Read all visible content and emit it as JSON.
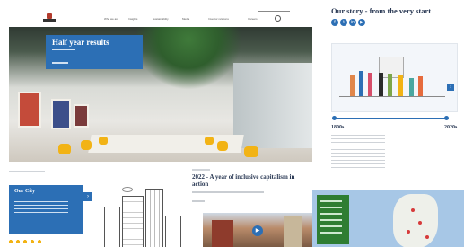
{
  "header": {
    "nav_items": [
      "Who we are",
      "Insights",
      "Sustainability",
      "Media",
      "Investor relations",
      "Careers"
    ]
  },
  "hero": {
    "title": "Half year results"
  },
  "story": {
    "title": "Our story - from the very start",
    "social_icons": [
      "facebook-icon",
      "twitter-icon",
      "linkedin-icon",
      "youtube-icon"
    ],
    "timeline_start": "1800s",
    "timeline_end": "2020s"
  },
  "article": {
    "title": "2022 - A year of inclusive capitalism in action"
  },
  "city_card": {
    "label": "Our City"
  },
  "colors": {
    "brand_blue": "#2c6fb5",
    "map_green": "#2e7d32",
    "sea_blue": "#a7c7e6"
  }
}
